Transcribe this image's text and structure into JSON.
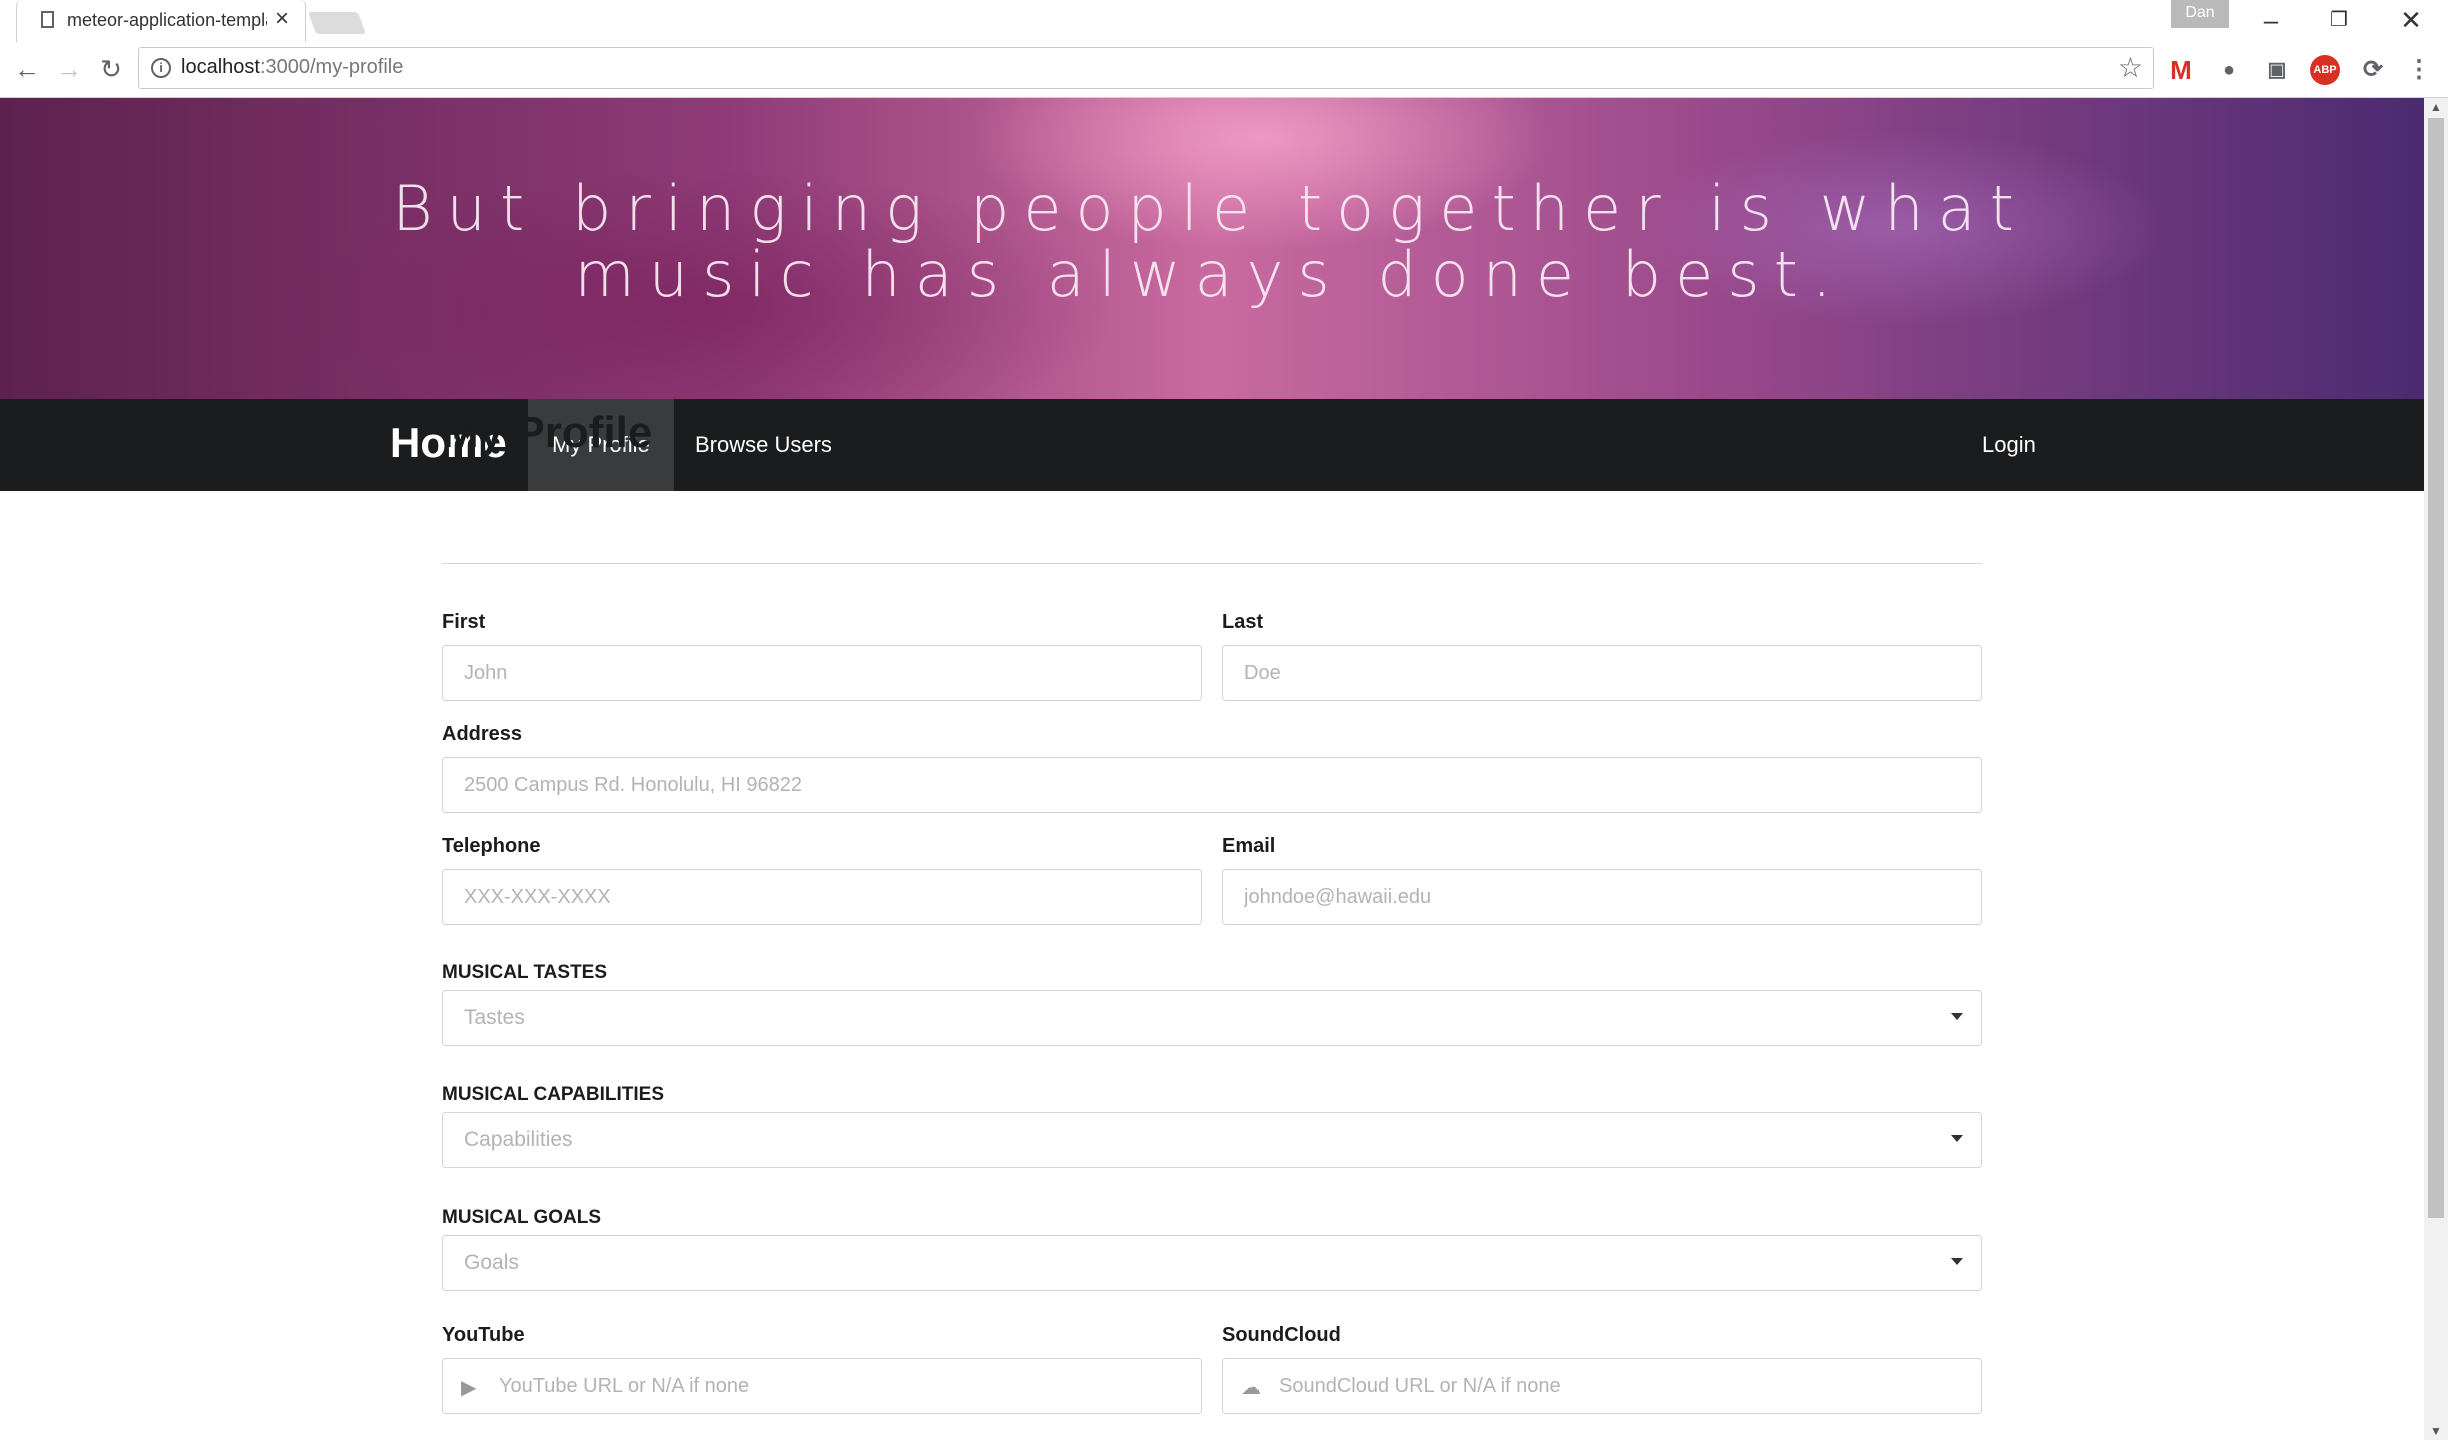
{
  "browser": {
    "tab_title": "meteor-application-template",
    "url_host": "localhost",
    "url_path": ":3000/my-profile",
    "profile_name": "Dan",
    "ext_gmail_label": "M",
    "ext_abp_label": "ABP"
  },
  "hero": {
    "quote": "But bringing people together is what music has always done best."
  },
  "navbar": {
    "brand": "Home",
    "items": [
      {
        "label": "My Profile"
      },
      {
        "label": "Browse Users"
      }
    ],
    "login_label": "Login"
  },
  "form": {
    "title": "My Profile",
    "first": {
      "label": "First",
      "placeholder": "John"
    },
    "last": {
      "label": "Last",
      "placeholder": "Doe"
    },
    "address": {
      "label": "Address",
      "placeholder": "2500 Campus Rd. Honolulu, HI 96822"
    },
    "telephone": {
      "label": "Telephone",
      "placeholder": "XXX-XXX-XXXX"
    },
    "email": {
      "label": "Email",
      "placeholder": "johndoe@hawaii.edu"
    },
    "tastes": {
      "label": "MUSICAL TASTES",
      "placeholder": "Tastes"
    },
    "capabilities": {
      "label": "MUSICAL CAPABILITIES",
      "placeholder": "Capabilities"
    },
    "goals": {
      "label": "MUSICAL GOALS",
      "placeholder": "Goals"
    },
    "youtube": {
      "label": "YouTube",
      "placeholder": "YouTube URL or N/A if none"
    },
    "soundcloud": {
      "label": "SoundCloud",
      "placeholder": "SoundCloud URL or N/A if none"
    }
  }
}
